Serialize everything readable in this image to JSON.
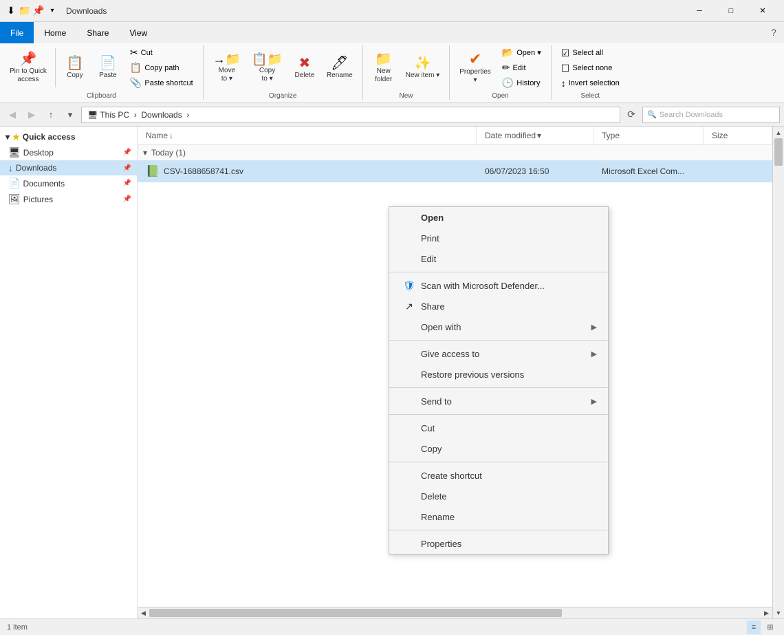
{
  "titleBar": {
    "title": "Downloads",
    "icons": [
      "↓",
      "📁",
      "📌"
    ],
    "winBtns": [
      "—",
      "□",
      "✕"
    ]
  },
  "ribbonTabs": [
    {
      "label": "File",
      "active": true
    },
    {
      "label": "Home",
      "active": false
    },
    {
      "label": "Share",
      "active": false
    },
    {
      "label": "View",
      "active": false
    }
  ],
  "ribbonGroups": {
    "clipboard": {
      "label": "Clipboard",
      "buttons": [
        {
          "icon": "📌",
          "label": "Pin to Quick\naccess"
        },
        {
          "icon": "📋",
          "label": "Copy"
        },
        {
          "icon": "📄",
          "label": "Paste"
        }
      ],
      "smallButtons": [
        {
          "icon": "✂",
          "label": "Cut"
        },
        {
          "icon": "📋",
          "label": "Copy path"
        },
        {
          "icon": "📎",
          "label": "Paste shortcut"
        }
      ]
    },
    "organize": {
      "label": "Organize",
      "buttons": [
        {
          "icon": "→",
          "label": "Move to"
        },
        {
          "icon": "📋",
          "label": "Copy to"
        },
        {
          "icon": "✖",
          "label": "Delete"
        },
        {
          "icon": "🖊",
          "label": "Rename"
        }
      ]
    },
    "new": {
      "label": "New",
      "buttons": [
        {
          "icon": "📁",
          "label": "New\nfolder"
        },
        {
          "icon": "✨",
          "label": "New item"
        }
      ]
    },
    "open": {
      "label": "Open",
      "buttons": [
        {
          "icon": "✔",
          "label": "Properties"
        }
      ],
      "smallButtons": [
        {
          "icon": "📂",
          "label": "Open"
        },
        {
          "icon": "✏",
          "label": "Edit"
        },
        {
          "icon": "🕒",
          "label": "History"
        }
      ]
    },
    "select": {
      "label": "Select",
      "smallButtons": [
        {
          "icon": "☑",
          "label": "Select all"
        },
        {
          "icon": "☐",
          "label": "Select none"
        },
        {
          "icon": "↕",
          "label": "Invert selection"
        }
      ]
    }
  },
  "addressBar": {
    "path": "This PC  ›  Downloads",
    "searchPlaceholder": "Search Downloads"
  },
  "navPane": {
    "quickAccess": {
      "label": "Quick access",
      "items": [
        {
          "icon": "🖥",
          "label": "Desktop",
          "pinned": true
        },
        {
          "icon": "↓",
          "label": "Downloads",
          "pinned": true,
          "selected": true
        },
        {
          "icon": "📄",
          "label": "Documents",
          "pinned": true
        },
        {
          "icon": "🖼",
          "label": "Pictures",
          "pinned": true
        }
      ]
    }
  },
  "filePane": {
    "columns": [
      {
        "label": "Name",
        "sortIcon": "↓"
      },
      {
        "label": "Date modified",
        "sortIcon": ""
      },
      {
        "label": "Type",
        "sortIcon": ""
      },
      {
        "label": "Size",
        "sortIcon": ""
      }
    ],
    "groups": [
      {
        "label": "Today (1)",
        "files": [
          {
            "icon": "📗",
            "name": "CSV-1688658741.csv",
            "date": "06/07/2023 16:50",
            "type": "Microsoft Excel Com...",
            "size": ""
          }
        ]
      }
    ]
  },
  "contextMenu": {
    "items": [
      {
        "label": "Open",
        "bold": true,
        "icon": "",
        "hasArrow": false
      },
      {
        "label": "Print",
        "bold": false,
        "icon": "",
        "hasArrow": false
      },
      {
        "label": "Edit",
        "bold": false,
        "icon": "",
        "hasArrow": false
      },
      {
        "separator": true
      },
      {
        "label": "Scan with Microsoft Defender...",
        "bold": false,
        "icon": "🛡",
        "hasArrow": false
      },
      {
        "label": "Share",
        "bold": false,
        "icon": "↗",
        "hasArrow": false
      },
      {
        "label": "Open with",
        "bold": false,
        "icon": "",
        "hasArrow": true
      },
      {
        "separator": true
      },
      {
        "label": "Give access to",
        "bold": false,
        "icon": "",
        "hasArrow": true
      },
      {
        "label": "Restore previous versions",
        "bold": false,
        "icon": "",
        "hasArrow": false
      },
      {
        "separator": true
      },
      {
        "label": "Send to",
        "bold": false,
        "icon": "",
        "hasArrow": true
      },
      {
        "separator": true
      },
      {
        "label": "Cut",
        "bold": false,
        "icon": "",
        "hasArrow": false
      },
      {
        "label": "Copy",
        "bold": false,
        "icon": "",
        "hasArrow": false
      },
      {
        "separator": true
      },
      {
        "label": "Create shortcut",
        "bold": false,
        "icon": "",
        "hasArrow": false
      },
      {
        "label": "Delete",
        "bold": false,
        "icon": "",
        "hasArrow": false
      },
      {
        "label": "Rename",
        "bold": false,
        "icon": "",
        "hasArrow": false
      },
      {
        "separator": true
      },
      {
        "label": "Properties",
        "bold": false,
        "icon": "",
        "hasArrow": false
      }
    ]
  },
  "statusBar": {
    "text": "1 item"
  }
}
